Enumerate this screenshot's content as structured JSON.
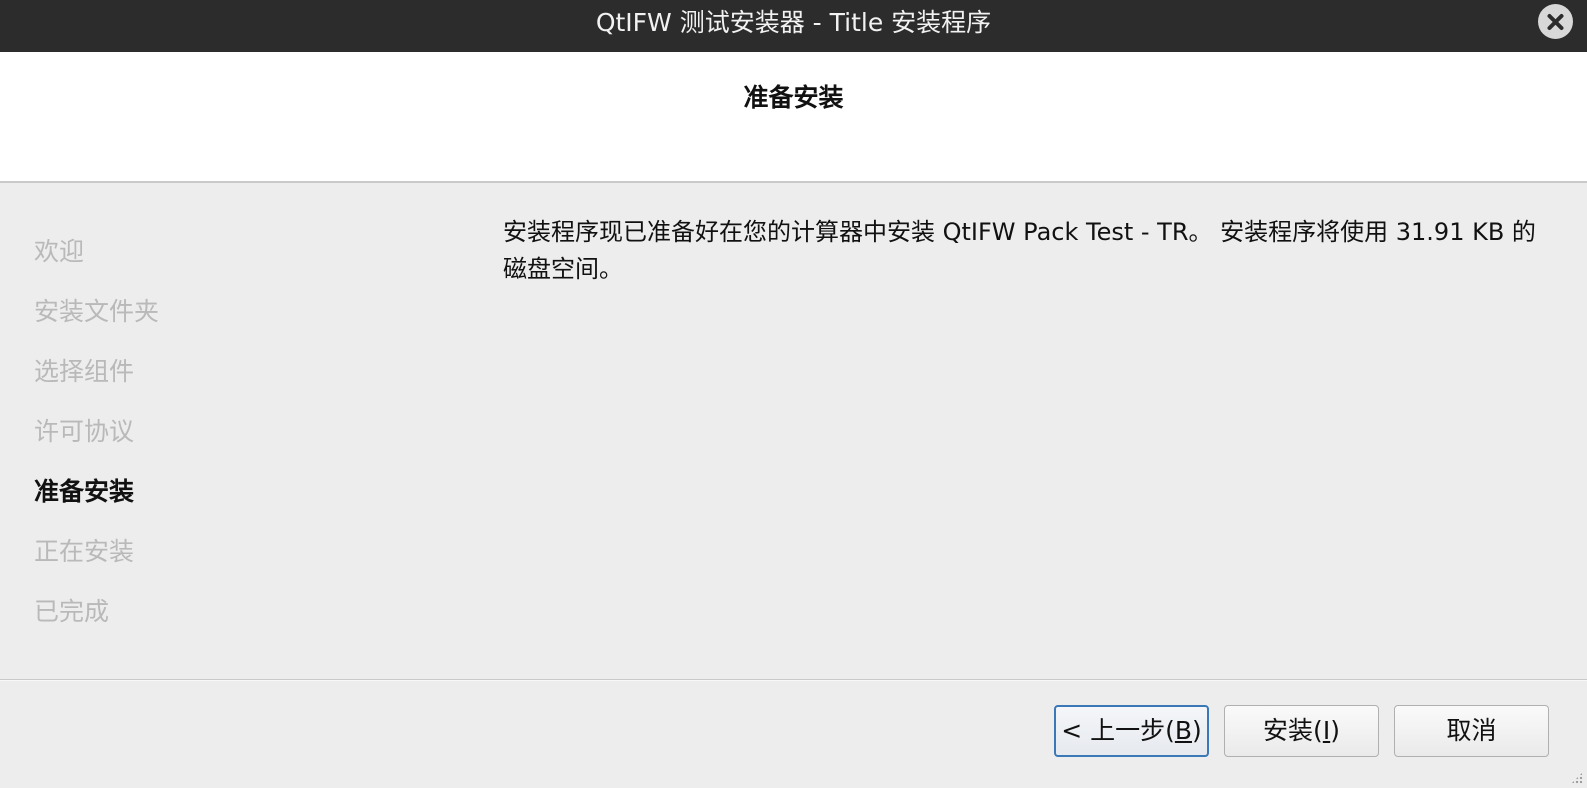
{
  "window": {
    "title": "QtIFW 测试安装器 - Title 安装程序"
  },
  "header": {
    "page_title": "准备安装"
  },
  "sidebar": {
    "steps": [
      {
        "label": "欢迎",
        "state": "done"
      },
      {
        "label": "安装文件夹",
        "state": "done"
      },
      {
        "label": "选择组件",
        "state": "done"
      },
      {
        "label": "许可协议",
        "state": "done"
      },
      {
        "label": "准备安装",
        "state": "current"
      },
      {
        "label": "正在安装",
        "state": "pending"
      },
      {
        "label": "已完成",
        "state": "pending"
      }
    ]
  },
  "main": {
    "message": "安装程序现已准备好在您的计算器中安装 QtIFW Pack Test - TR。 安装程序将使用 31.91 KB 的磁盘空间。"
  },
  "buttons": {
    "back": {
      "prefix": "< 上一步(",
      "mnemonic": "B",
      "suffix": ")"
    },
    "install": {
      "prefix": "安装(",
      "mnemonic": "I",
      "suffix": ")"
    },
    "cancel": {
      "label": "取消"
    }
  },
  "colors": {
    "titlebar": "#2c2c2c",
    "focus_border": "#3b78b7",
    "disabled_text": "#b9b9b9"
  }
}
